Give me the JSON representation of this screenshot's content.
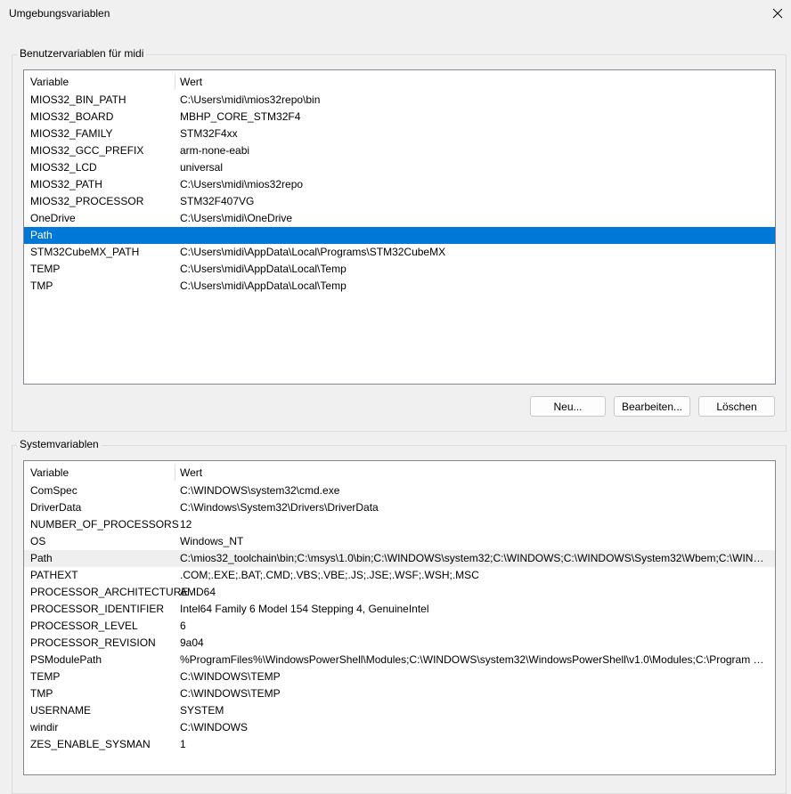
{
  "window": {
    "title": "Umgebungsvariablen"
  },
  "user_section": {
    "legend": "Benutzervariablen für midi",
    "headers": {
      "variable": "Variable",
      "value": "Wert"
    },
    "rows": [
      {
        "name": "MIOS32_BIN_PATH",
        "value": "C:\\Users\\midi\\mios32repo\\bin"
      },
      {
        "name": "MIOS32_BOARD",
        "value": "MBHP_CORE_STM32F4"
      },
      {
        "name": "MIOS32_FAMILY",
        "value": "STM32F4xx"
      },
      {
        "name": "MIOS32_GCC_PREFIX",
        "value": "arm-none-eabi"
      },
      {
        "name": "MIOS32_LCD",
        "value": "universal"
      },
      {
        "name": "MIOS32_PATH",
        "value": "C:\\Users\\midi\\mios32repo"
      },
      {
        "name": "MIOS32_PROCESSOR",
        "value": "STM32F407VG"
      },
      {
        "name": "OneDrive",
        "value": "C:\\Users\\midi\\OneDrive"
      },
      {
        "name": "Path",
        "value": ""
      },
      {
        "name": "STM32CubeMX_PATH",
        "value": "C:\\Users\\midi\\AppData\\Local\\Programs\\STM32CubeMX"
      },
      {
        "name": "TEMP",
        "value": "C:\\Users\\midi\\AppData\\Local\\Temp"
      },
      {
        "name": "TMP",
        "value": "C:\\Users\\midi\\AppData\\Local\\Temp"
      }
    ],
    "selected_row": "Path",
    "buttons": {
      "new": "Neu...",
      "edit": "Bearbeiten...",
      "delete": "Löschen"
    }
  },
  "system_section": {
    "legend": "Systemvariablen",
    "headers": {
      "variable": "Variable",
      "value": "Wert"
    },
    "rows": [
      {
        "name": "ComSpec",
        "value": "C:\\WINDOWS\\system32\\cmd.exe"
      },
      {
        "name": "DriverData",
        "value": "C:\\Windows\\System32\\Drivers\\DriverData"
      },
      {
        "name": "NUMBER_OF_PROCESSORS",
        "value": "12"
      },
      {
        "name": "OS",
        "value": "Windows_NT"
      },
      {
        "name": "Path",
        "value": "C:\\mios32_toolchain\\bin;C:\\msys\\1.0\\bin;C:\\WINDOWS\\system32;C:\\WINDOWS;C:\\WINDOWS\\System32\\Wbem;C:\\WIND..."
      },
      {
        "name": "PATHEXT",
        "value": ".COM;.EXE;.BAT;.CMD;.VBS;.VBE;.JS;.JSE;.WSF;.WSH;.MSC"
      },
      {
        "name": "PROCESSOR_ARCHITECTURE",
        "value": "AMD64"
      },
      {
        "name": "PROCESSOR_IDENTIFIER",
        "value": "Intel64 Family 6 Model 154 Stepping 4, GenuineIntel"
      },
      {
        "name": "PROCESSOR_LEVEL",
        "value": "6"
      },
      {
        "name": "PROCESSOR_REVISION",
        "value": "9a04"
      },
      {
        "name": "PSModulePath",
        "value": "%ProgramFiles%\\WindowsPowerShell\\Modules;C:\\WINDOWS\\system32\\WindowsPowerShell\\v1.0\\Modules;C:\\Program Fil..."
      },
      {
        "name": "TEMP",
        "value": "C:\\WINDOWS\\TEMP"
      },
      {
        "name": "TMP",
        "value": "C:\\WINDOWS\\TEMP"
      },
      {
        "name": "USERNAME",
        "value": "SYSTEM"
      },
      {
        "name": "windir",
        "value": "C:\\WINDOWS"
      },
      {
        "name": "ZES_ENABLE_SYSMAN",
        "value": "1"
      }
    ],
    "hover_row": "Path"
  },
  "icons": {
    "close": "close-icon"
  },
  "colors": {
    "selection": "#0078d7",
    "hover": "#efefef",
    "background": "#f0f0f0"
  }
}
